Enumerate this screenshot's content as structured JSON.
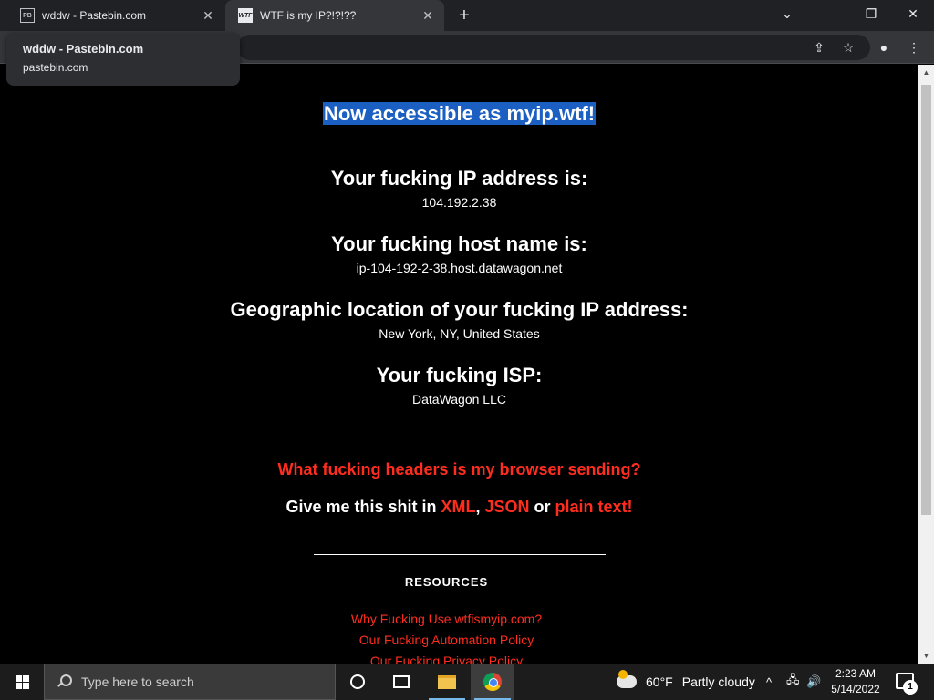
{
  "browser": {
    "tabs": [
      {
        "title": "wddw - Pastebin.com",
        "favicon": "pastebin-icon",
        "active": false
      },
      {
        "title": "WTF is my IP?!?!??",
        "favicon": "wtf-icon",
        "active": true
      }
    ],
    "tab_close_glyph": "✕",
    "new_tab_glyph": "+",
    "window_controls": {
      "minimize": "—",
      "maximize": "❐",
      "close": "✕",
      "tab_search": "⌄"
    },
    "toolbar_icons": {
      "share": "⇪",
      "bookmark": "☆",
      "profile": "●",
      "menu": "⋮"
    },
    "tooltip": {
      "title": "wddw - Pastebin.com",
      "url": "pastebin.com"
    }
  },
  "page": {
    "banner": "Now accessible as myip.wtf!",
    "sections": [
      {
        "heading": "Your fucking IP address is:",
        "value": "104.192.2.38"
      },
      {
        "heading": "Your fucking host name is:",
        "value": "ip-104-192-2-38.host.datawagon.net"
      },
      {
        "heading": "Geographic location of your fucking IP address:",
        "value": "New York, NY, United States"
      },
      {
        "heading": "Your fucking ISP:",
        "value": "DataWagon LLC"
      }
    ],
    "headers_link": "What fucking headers is my browser sending?",
    "give_me": {
      "prefix": "Give me this shit in ",
      "xml": "XML",
      "comma": ", ",
      "json": "JSON",
      "or": " or ",
      "plain": "plain text!"
    },
    "resources": {
      "heading": "RESOURCES",
      "links": [
        "Why Fucking Use wtfismyip.com?",
        "Our Fucking Automation Policy",
        "Our Fucking Privacy Policy"
      ]
    },
    "colors": {
      "background": "#000000",
      "text": "#ffffff",
      "link_red": "#ff2d1f",
      "banner_highlight": "#1b5fc2"
    }
  },
  "taskbar": {
    "search_placeholder": "Type here to search",
    "weather": {
      "temp": "60°F",
      "condition": "Partly cloudy"
    },
    "tray_icons": {
      "chevron": "^",
      "network": "🖧",
      "volume": "🔊"
    },
    "clock": {
      "time": "2:23 AM",
      "date": "5/14/2022"
    },
    "notification_count": "1"
  }
}
